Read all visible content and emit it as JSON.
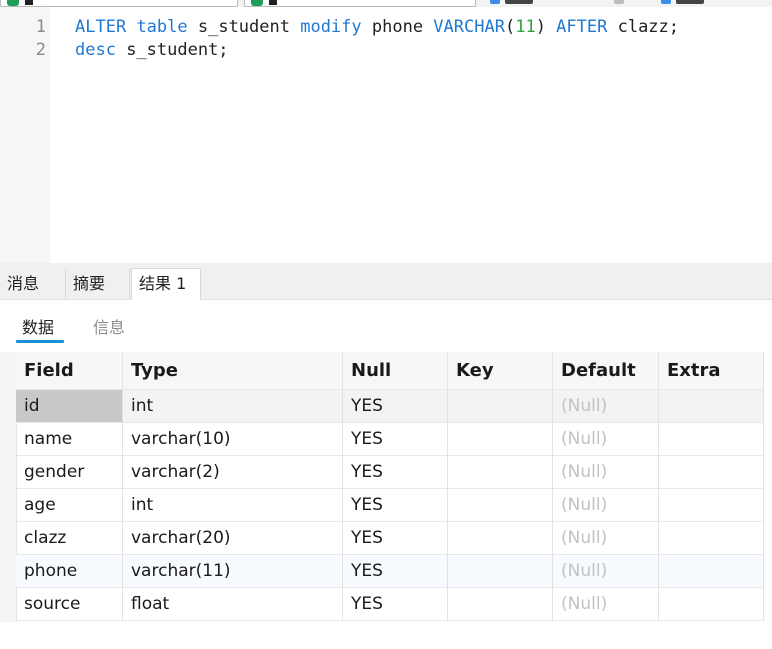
{
  "editor": {
    "line_numbers": [
      "1",
      "2"
    ],
    "line1": {
      "tokens": [
        {
          "text": "ALTER",
          "kind": "kw"
        },
        {
          "text": " ",
          "kind": "plain"
        },
        {
          "text": "table",
          "kind": "kw"
        },
        {
          "text": " s_student ",
          "kind": "plain"
        },
        {
          "text": "modify",
          "kind": "kw"
        },
        {
          "text": " phone ",
          "kind": "plain"
        },
        {
          "text": "VARCHAR",
          "kind": "kw"
        },
        {
          "text": "(",
          "kind": "plain"
        },
        {
          "text": "11",
          "kind": "num"
        },
        {
          "text": ") ",
          "kind": "plain"
        },
        {
          "text": "AFTER",
          "kind": "kw"
        },
        {
          "text": " clazz;",
          "kind": "plain"
        }
      ]
    },
    "line2": {
      "tokens": [
        {
          "text": "desc",
          "kind": "kw"
        },
        {
          "text": " s_student;",
          "kind": "plain"
        }
      ]
    }
  },
  "bottom_tabs": [
    "消息",
    "摘要",
    "结果 1"
  ],
  "result_subtabs": [
    "数据",
    "信息"
  ],
  "grid": {
    "columns": [
      "Field",
      "Type",
      "Null",
      "Key",
      "Default",
      "Extra"
    ],
    "rows": [
      [
        "id",
        "int",
        "YES",
        "",
        "(Null)",
        ""
      ],
      [
        "name",
        "varchar(10)",
        "YES",
        "",
        "(Null)",
        ""
      ],
      [
        "gender",
        "varchar(2)",
        "YES",
        "",
        "(Null)",
        ""
      ],
      [
        "age",
        "int",
        "YES",
        "",
        "(Null)",
        ""
      ],
      [
        "clazz",
        "varchar(20)",
        "YES",
        "",
        "(Null)",
        ""
      ],
      [
        "phone",
        "varchar(11)",
        "YES",
        "",
        "(Null)",
        ""
      ],
      [
        "source",
        "float",
        "YES",
        "",
        "(Null)",
        ""
      ]
    ]
  },
  "colors": {
    "keyword": "#1f78d1",
    "number": "#2aa33a",
    "null_text": "#c2c2c2",
    "subtab_accent": "#1a8fd6"
  }
}
